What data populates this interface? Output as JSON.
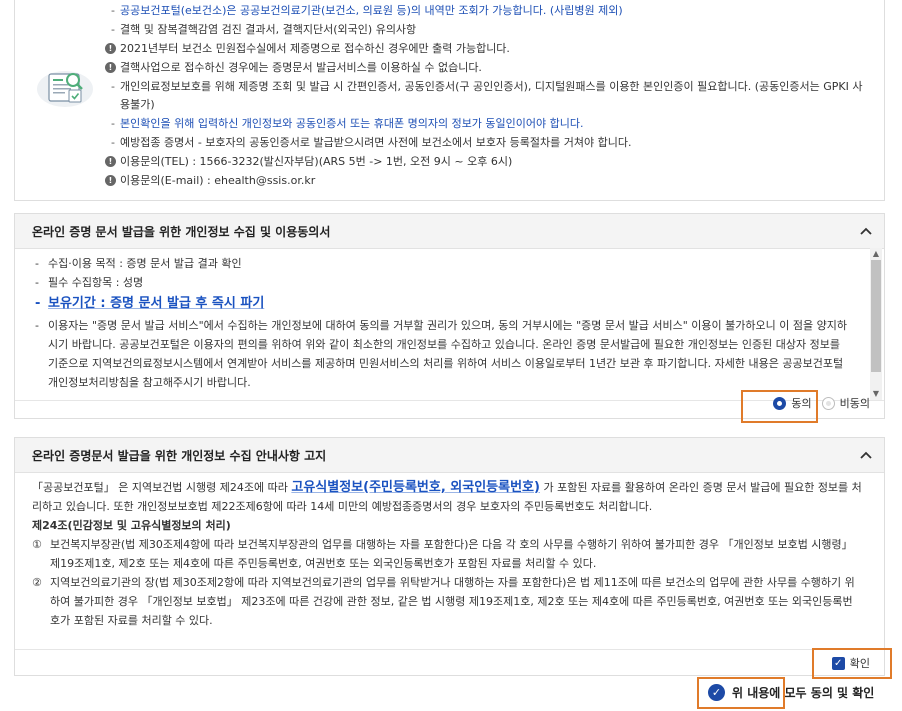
{
  "info": {
    "rows": [
      {
        "marker": "-",
        "text": "공공보건포털(e보건소)은 공공보건의료기관(보건소, 의료원 등)의 내역만 조회가 가능합니다. (사립병원 제외)",
        "style": "blue"
      },
      {
        "marker": "-",
        "text": "결핵 및 잠복결핵감염 검진 결과서, 결핵지단서(외국인) 유의사항",
        "style": ""
      },
      {
        "marker": "!",
        "text": "2021년부터 보건소 민원접수실에서 제증명으로 접수하신 경우에만 출력 가능합니다.",
        "style": ""
      },
      {
        "marker": "!",
        "text": "결핵사업으로 접수하신 경우에는 증명문서 발급서비스를 이용하실 수 없습니다.",
        "style": ""
      },
      {
        "marker": "-",
        "text": "개인의료정보보호를 위해 제증명 조회 및 발급 시 간편인증서, 공동인증서(구 공인인증서), 디지털원패스를 이용한 본인인증이 필요합니다. (공동인증서는 GPKI 사용불가)",
        "style": ""
      },
      {
        "marker": "-",
        "text": "본인확인을 위해 입력하신 개인정보와 공동인증서 또는 휴대폰 명의자의 정보가 동일인이어야 합니다.",
        "style": "blue"
      },
      {
        "marker": "-",
        "text": "예방접종 증명서 - 보호자의 공동인증서로 발급받으시려면 사전에 보건소에서 보호자 등록절차를 거쳐야 합니다.",
        "style": ""
      },
      {
        "marker": "!",
        "text": "이용문의(TEL) : 1566-3232(발신자부담)(ARS 5번 -> 1번, 오전 9시 ~ 오후 6시)",
        "style": ""
      },
      {
        "marker": "!",
        "text": "이용문의(E-mail) : ehealth@ssis.or.kr",
        "style": ""
      }
    ]
  },
  "consent": {
    "title": "온라인 증명 문서 발급을 위한 개인정보 수집 및 이용동의서",
    "items": [
      {
        "text": "수집·이용 목적 : 증명 문서 발급 결과 확인",
        "big": false
      },
      {
        "text": "필수 수집항목 : 성명",
        "big": false
      },
      {
        "text": "보유기간 : 증명 문서 발급 후 즉시 파기",
        "big": true
      },
      {
        "text": "이용자는 \"증명 문서 발급 서비스\"에서 수집하는 개인정보에 대하여 동의를 거부할 권리가 있으며, 동의 거부시에는 \"증명 문서 발급 서비스\" 이용이 불가하오니 이 점을 양지하시기 바랍니다. 공공보건포털은 이용자의 편의를 위하여 위와 같이 최소한의 개인정보를 수집하고 있습니다. 온라인 증명 문서발급에 필요한 개인정보는 인증된 대상자 정보를 기준으로 지역보건의료정보시스템에서 연계받아 서비스를 제공하며 민원서비스의 처리를 위하여 서비스 이용일로부터 1년간 보관 후 파기합니다. 자세한 내용은 공공보건포털 개인정보처리방침을 참고해주시기 바랍니다.",
        "big": false
      }
    ],
    "agree_label": "동의",
    "disagree_label": "비동의"
  },
  "notice": {
    "title": "온라인 증명문서 발급을 위한 개인정보 수집 안내사항 고지",
    "p1_a": "「공공보건포털」 은 지역보건법 시행령 제24조에 따라 ",
    "p1_b": "고유식별정보(주민등록번호, 외국인등록번호)",
    "p1_c": " 가 포함된 자료를 활용하여 온라인 증명 문서 발급에 필요한 정보를 처리하고 있습니다. 또한 개인정보보호법 제22조제6항에 따라 14세 미만의 예방접종증명서의 경우 보호자의 주민등록번호도 처리합니다.",
    "article": "제24조(민감정보 및 고유식별정보의 처리)",
    "items": [
      {
        "num": "①",
        "text": "보건복지부장관(법 제30조제4항에 따라 보건복지부장관의 업무를 대행하는 자를 포함한다)은 다음 각 호의 사무를 수행하기 위하여 불가피한 경우 「개인정보 보호법 시행령」 제19조제1호, 제2호 또는 제4호에 따른 주민등록번호, 여권번호 또는 외국인등록번호가 포함된 자료를 처리할 수 있다."
      },
      {
        "num": "②",
        "text": "지역보건의료기관의 장(법 제30조제2항에 따라 지역보건의료기관의 업무를 위탁받거나 대행하는 자를 포함한다)은 법 제11조에 따른 보건소의 업무에 관한 사무를 수행하기 위하여 불가피한 경우 「개인정보 보호법」 제23조에 따른 건강에 관한 정보, 같은 법 시행령 제19조제1호, 제2호 또는 제4호에 따른 주민등록번호, 여권번호 또는 외국인등록번호가 포함된 자료를 처리할 수 있다."
      }
    ],
    "confirm_label": "확인"
  },
  "all_agree_label": "위 내용에 모두 동의 및 확인",
  "colors": {
    "accent": "#1d4aa6",
    "highlight": "#e07b2a",
    "link_blue": "#1a52c0"
  }
}
